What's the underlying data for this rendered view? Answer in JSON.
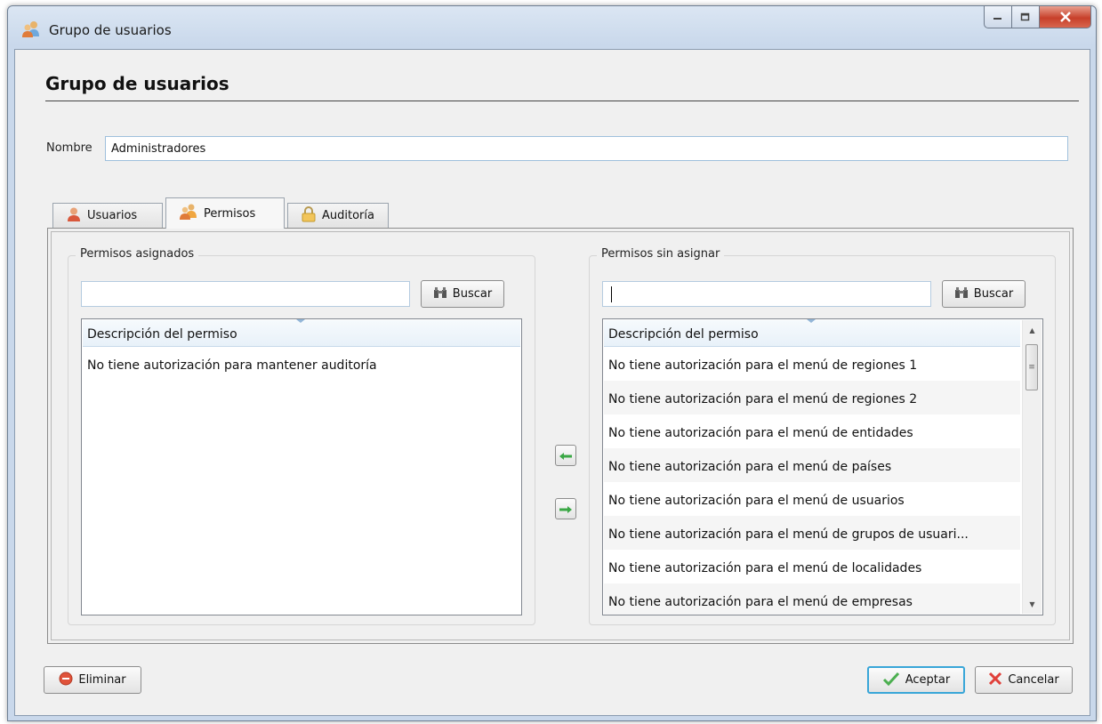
{
  "window": {
    "title": "Grupo de usuarios"
  },
  "form": {
    "heading": "Grupo de usuarios",
    "nombre_label": "Nombre",
    "nombre_value": "Administradores"
  },
  "tabs": [
    {
      "label": "Usuarios",
      "icon": "user-icon"
    },
    {
      "label": "Permisos",
      "icon": "users-group-icon",
      "active": true
    },
    {
      "label": "Auditoría",
      "icon": "lock-icon"
    }
  ],
  "assigned": {
    "title": "Permisos asignados",
    "search_value": "",
    "search_button": "Buscar",
    "column": "Descripción del permiso",
    "rows": [
      "No tiene autorización para mantener auditoría"
    ]
  },
  "unassigned": {
    "title": "Permisos sin asignar",
    "search_value": "",
    "search_button": "Buscar",
    "column": "Descripción del permiso",
    "rows": [
      "No tiene autorización para el menú de regiones 1",
      "No tiene autorización para el menú de regiones 2",
      "No tiene autorización para el menú de entidades",
      "No tiene autorización para el menú de países",
      "No tiene autorización para el menú de usuarios",
      "No tiene autorización para el menú de grupos de usuari...",
      "No tiene autorización para el menú de localidades",
      "No tiene autorización para el menú de empresas"
    ]
  },
  "footer": {
    "delete_label": "Eliminar",
    "accept_label": "Aceptar",
    "cancel_label": "Cancelar"
  },
  "colors": {
    "accent": "#39a6d8",
    "green_arrow": "#3aa845",
    "window_frame": "#c9d8eb"
  }
}
